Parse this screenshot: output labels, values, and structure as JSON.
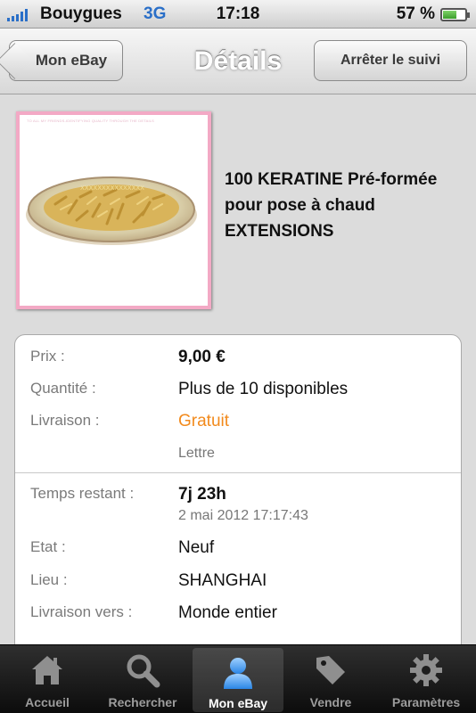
{
  "status_bar": {
    "carrier": "Bouygues",
    "network": "3G",
    "time": "17:18",
    "battery": "57 %"
  },
  "nav": {
    "back_label": "Mon eBay",
    "title": "Détails",
    "follow_label": "Arrêter le suivi"
  },
  "product": {
    "image_caption": "TO ALL MY FRIENDS-IDENTIFYING QUALITY THROUGH THE DETAILS",
    "title": "100 KERATINE Pré-formée pour pose à chaud EXTENSIONS"
  },
  "details": {
    "price_label": "Prix :",
    "price": "9,00 €",
    "quantity_label": "Quantité :",
    "quantity": "Plus de 10 disponibles",
    "shipping_label": "Livraison :",
    "shipping": "Gratuit",
    "shipping_method": "Lettre",
    "time_left_label": "Temps restant :",
    "time_left": "7j 23h",
    "end_date": "2 mai 2012 17:17:43",
    "condition_label": "Etat :",
    "condition": "Neuf",
    "location_label": "Lieu :",
    "location": "SHANGHAI",
    "ships_to_label": "Livraison vers :",
    "ships_to": "Monde entier"
  },
  "tabs": [
    {
      "label": "Accueil",
      "icon": "home-icon"
    },
    {
      "label": "Rechercher",
      "icon": "search-icon"
    },
    {
      "label": "Mon eBay",
      "icon": "person-icon",
      "active": true
    },
    {
      "label": "Vendre",
      "icon": "tag-icon"
    },
    {
      "label": "Paramètres",
      "icon": "gear-icon"
    }
  ],
  "colors": {
    "accent_blue": "#2a6fc8",
    "free_shipping": "#f28a1c",
    "image_border": "#f3a9c5"
  }
}
